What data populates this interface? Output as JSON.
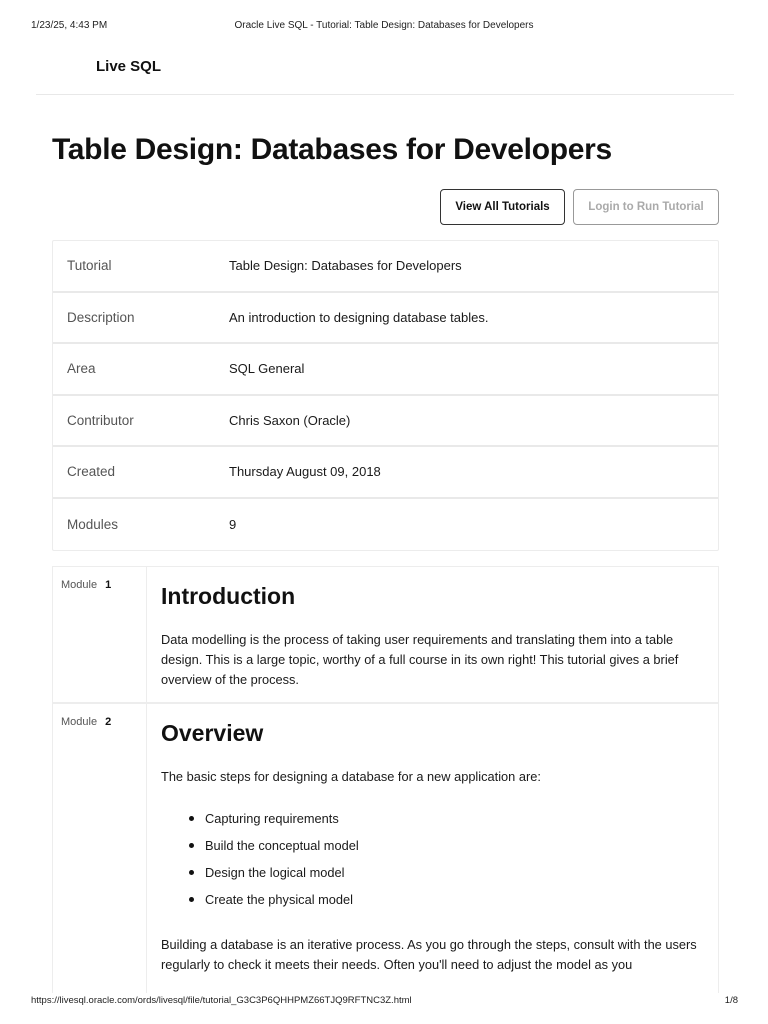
{
  "print_header": {
    "datetime": "1/23/25, 4:43 PM",
    "title": "Oracle Live SQL - Tutorial: Table Design: Databases for Developers"
  },
  "app": {
    "brand": "Live SQL"
  },
  "page": {
    "title": "Table Design: Databases for Developers",
    "view_all_label": "View All Tutorials",
    "login_label": "Login to Run Tutorial"
  },
  "info_rows": [
    {
      "label": "Tutorial",
      "value": "Table Design: Databases for Developers"
    },
    {
      "label": "Description",
      "value": "An introduction to designing database tables."
    },
    {
      "label": "Area",
      "value": "SQL General"
    },
    {
      "label": "Contributor",
      "value": "Chris Saxon (Oracle)"
    },
    {
      "label": "Created",
      "value": "Thursday August 09, 2018"
    },
    {
      "label": "Modules",
      "value": "9"
    }
  ],
  "modules": [
    {
      "label": "Module",
      "number": "1",
      "title": "Introduction",
      "text": "Data modelling is the process of taking user requirements and translating them into a table design. This is a large topic, worthy of a full course in its own right! This tutorial gives a brief overview of the process."
    },
    {
      "label": "Module",
      "number": "2",
      "title": "Overview",
      "intro": "The basic steps for designing a database for a new application are:",
      "bullets": [
        "Capturing requirements",
        "Build the conceptual model",
        "Design the logical model",
        "Create the physical model"
      ],
      "text": "Building a database is an iterative process. As you go through the steps, consult with the users regularly to check it meets their needs. Often you'll need to adjust the model as you"
    }
  ],
  "print_footer": {
    "url": "https://livesql.oracle.com/ords/livesql/file/tutorial_G3C3P6QHHPMZ66TJQ9RFTNC3Z.html",
    "page": "1/8"
  }
}
